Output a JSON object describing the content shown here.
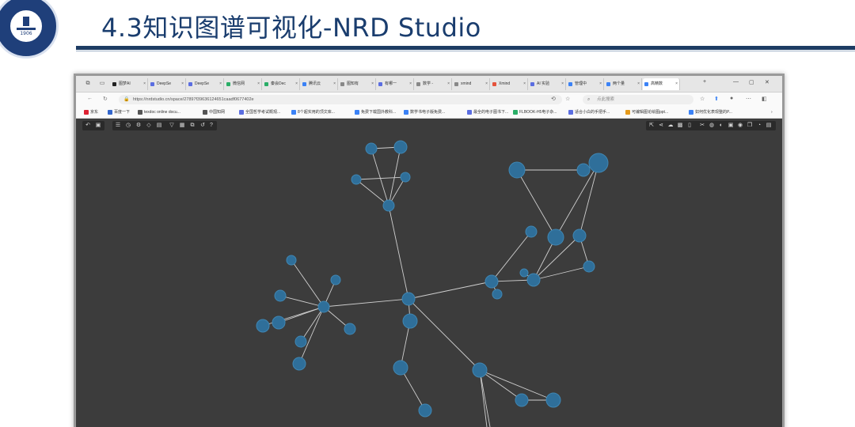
{
  "slide": {
    "title": "4.3知识图谱可视化-NRD Studio",
    "logo_year": "1906"
  },
  "browser": {
    "tabs": [
      {
        "label": "图梦AI",
        "color": "#222"
      },
      {
        "label": "DeepSe",
        "color": "#5b6ee1"
      },
      {
        "label": "DeepSe",
        "color": "#5b6ee1"
      },
      {
        "label": "微信网",
        "color": "#2aae67"
      },
      {
        "label": "秦会Dec",
        "color": "#2aae67"
      },
      {
        "label": "腾讯云",
        "color": "#3b82f6"
      },
      {
        "label": "图知有",
        "color": "#888"
      },
      {
        "label": "有哪一",
        "color": "#5b6ee1"
      },
      {
        "label": "数学 -",
        "color": "#888"
      },
      {
        "label": "xmind",
        "color": "#888"
      },
      {
        "label": "Xmind",
        "color": "#e5533c"
      },
      {
        "label": "AI 实验",
        "color": "#5b6ee1"
      },
      {
        "label": "管理中",
        "color": "#3b82f6"
      },
      {
        "label": "两个量",
        "color": "#3b82f6"
      },
      {
        "label": "高精数",
        "color": "#3b82f6",
        "active": true
      }
    ],
    "url": "https://nrdstudio.cn/space/27897f39636124651caadf0677402e",
    "search_placeholder": "点此搜索",
    "bookmarks": [
      {
        "label": "京东",
        "color": "#d23"
      },
      {
        "label": "百度一下",
        "color": "#36c"
      },
      {
        "label": "texdoc online docu...",
        "color": "#555"
      },
      {
        "label": "中国知网",
        "color": "#555"
      },
      {
        "label": "全国哲学考试概观...",
        "color": "#5b6ee1"
      },
      {
        "label": "8个超实用的顶文库...",
        "color": "#3b82f6"
      },
      {
        "label": "免费下载国外教科...",
        "color": "#3b82f6"
      },
      {
        "label": "数学书电子版免费...",
        "color": "#3b82f6"
      },
      {
        "label": "最全的电子图书下...",
        "color": "#5b6ee1"
      },
      {
        "label": "FLBOOK-H5电子杂...",
        "color": "#2aae67"
      },
      {
        "label": "适合小白的手把手...",
        "color": "#5b6ee1"
      },
      {
        "label": "可编辑图论绘图ppt...",
        "color": "#e59a1b"
      },
      {
        "label": "如何优化表现整的P...",
        "color": "#3b82f6"
      }
    ]
  }
}
